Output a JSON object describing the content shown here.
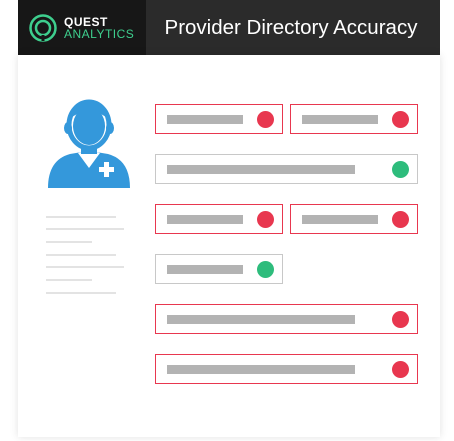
{
  "header": {
    "logo_line1": "QUEST",
    "logo_line2": "ANALYTICS",
    "title": "Provider Directory Accuracy"
  },
  "colors": {
    "error": "#e8374f",
    "valid": "#2ebc7c",
    "placeholder": "#b3b3b3",
    "header_bg": "#2b2b2b",
    "avatar": "#3498db"
  },
  "icons": {
    "avatar": "doctor-avatar-icon",
    "logo": "quest-logo-icon"
  },
  "fields": [
    {
      "name": "field-row1-left",
      "status": "invalid"
    },
    {
      "name": "field-row1-right",
      "status": "invalid"
    },
    {
      "name": "field-row2",
      "status": "valid"
    },
    {
      "name": "field-row3-left",
      "status": "invalid"
    },
    {
      "name": "field-row3-right",
      "status": "invalid"
    },
    {
      "name": "field-row4",
      "status": "valid"
    },
    {
      "name": "field-row5",
      "status": "invalid"
    },
    {
      "name": "field-row6",
      "status": "invalid"
    }
  ]
}
